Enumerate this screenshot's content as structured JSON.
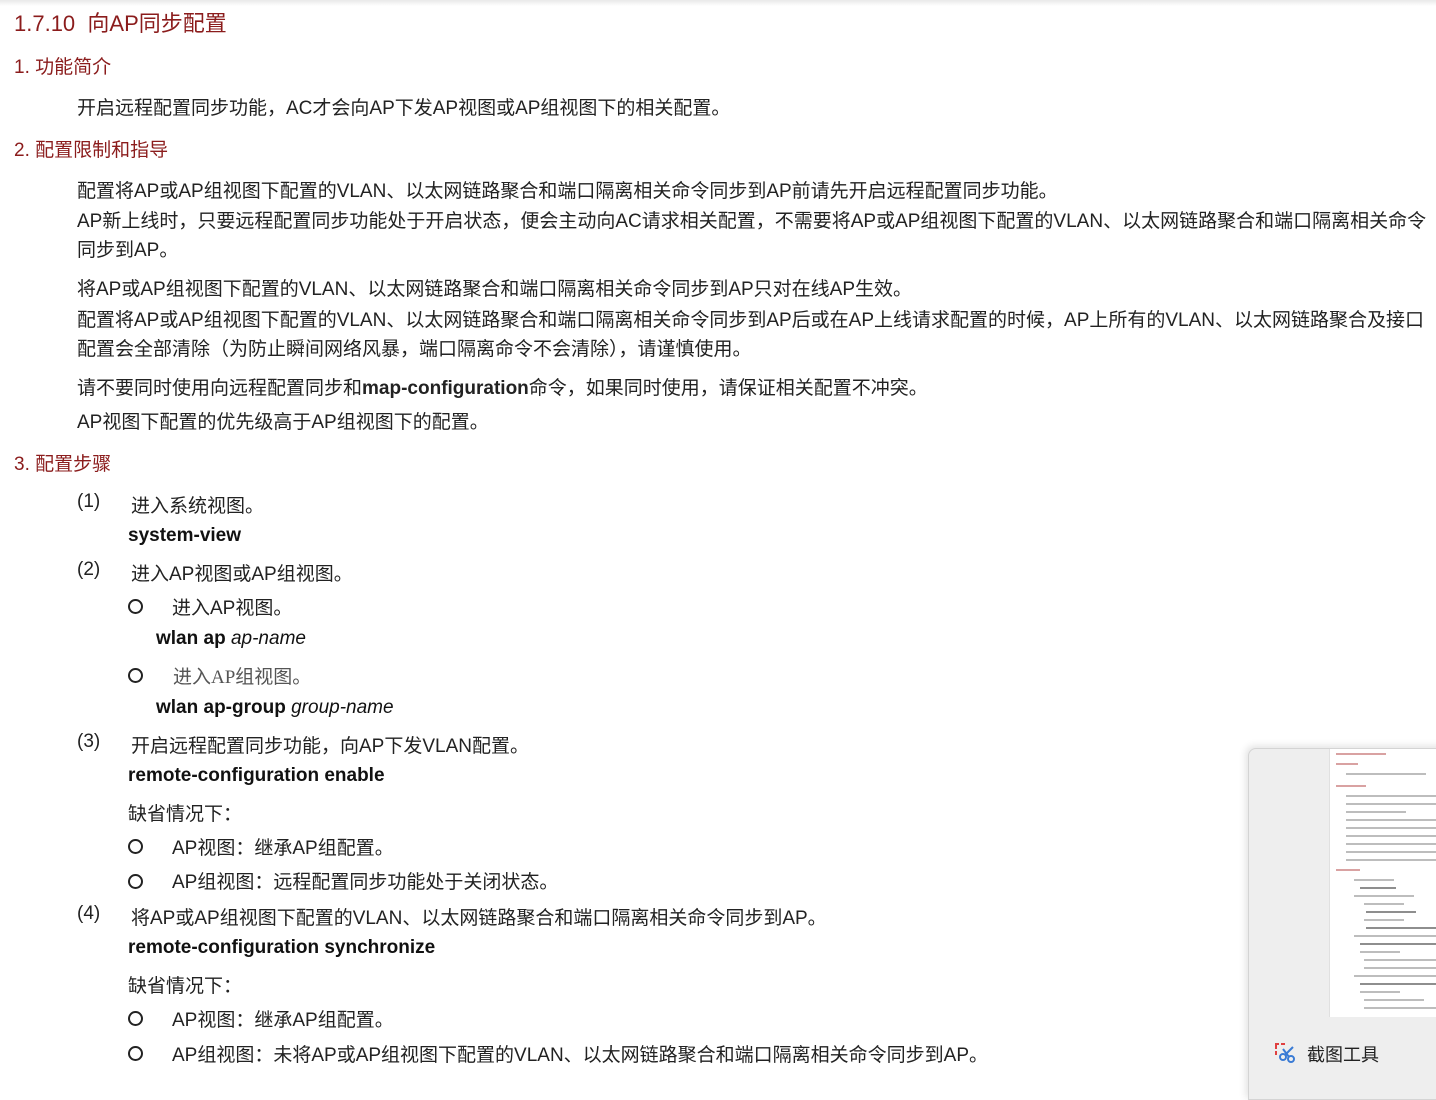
{
  "heading": {
    "number": "1.7.10",
    "title": "向AP同步配置"
  },
  "sections": {
    "s1": {
      "title": "1. 功能简介",
      "text": "开启远程配置同步功能，AC才会向AP下发AP视图或AP组视图下的相关配置。"
    },
    "s2": {
      "title": "2. 配置限制和指导",
      "p1": "配置将AP或AP组视图下配置的VLAN、以太网链路聚合和端口隔离相关命令同步到AP前请先开启远程配置同步功能。",
      "p2": "AP新上线时，只要远程配置同步功能处于开启状态，便会主动向AC请求相关配置，不需要将AP或AP组视图下配置的VLAN、以太网链路聚合和端口隔离相关命令同步到AP。",
      "p3": "将AP或AP组视图下配置的VLAN、以太网链路聚合和端口隔离相关命令同步到AP只对在线AP生效。",
      "p4": "配置将AP或AP组视图下配置的VLAN、以太网链路聚合和端口隔离相关命令同步到AP后或在AP上线请求配置的时候，AP上所有的VLAN、以太网链路聚合及接口配置会全部清除（为防止瞬间网络风暴，端口隔离命令不会清除），请谨慎使用。",
      "p5_pre": "请不要同时使用向远程配置同步和",
      "p5_cmd": "map-configuration",
      "p5_post": "命令，如果同时使用，请保证相关配置不冲突。",
      "p6": "AP视图下配置的优先级高于AP组视图下的配置。"
    },
    "s3": {
      "title": "3. 配置步骤",
      "step1": {
        "num": "(1)",
        "text": "进入系统视图。",
        "cmd": "system-view"
      },
      "step2": {
        "num": "(2)",
        "text": "进入AP视图或AP组视图。",
        "b1": "进入AP视图。",
        "b1_cmd": "wlan ap",
        "b1_arg": "ap-name",
        "b2": "进入AP组视图。",
        "b2_cmd": "wlan ap-group",
        "b2_arg": "group-name"
      },
      "step3": {
        "num": "(3)",
        "text": "开启远程配置同步功能，向AP下发VLAN配置。",
        "cmd": "remote-configuration enable",
        "default": "缺省情况下：",
        "d1": "AP视图：继承AP组配置。",
        "d2": "AP组视图：远程配置同步功能处于关闭状态。"
      },
      "step4": {
        "num": "(4)",
        "text": "将AP或AP组视图下配置的VLAN、以太网链路聚合和端口隔离相关命令同步到AP。",
        "cmd": "remote-configuration synchronize",
        "default": "缺省情况下：",
        "d1": "AP视图：继承AP组配置。",
        "d2": "AP组视图：未将AP或AP组视图下配置的VLAN、以太网链路聚合和端口隔离相关命令同步到AP。"
      }
    }
  },
  "snipping_tool": {
    "label": "截图工具",
    "icon": "scissors-icon"
  }
}
